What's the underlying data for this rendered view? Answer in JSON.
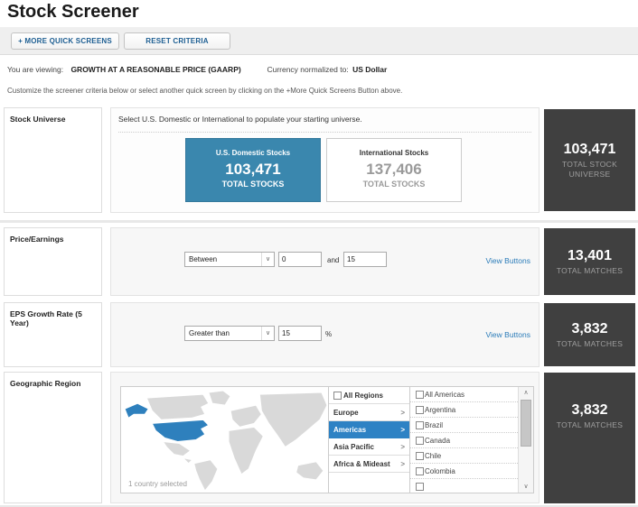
{
  "page": {
    "title": "Stock Screener"
  },
  "toolbar": {
    "more_quick_screens": "+ MORE QUICK SCREENS",
    "reset_criteria": "RESET CRITERIA"
  },
  "status": {
    "viewing_label": "You are viewing:",
    "viewing_value": "GROWTH AT A REASONABLE PRICE (GAARP)",
    "currency_label": "Currency normalized to:",
    "currency_value": "US Dollar",
    "instructions": "Customize the screener criteria below or select another quick screen by clicking on the +More Quick Screens Button above."
  },
  "colors": {
    "selected_card_blue": "#3a87ae",
    "selected_region_blue": "#2e82c4",
    "dark_panel": "#404040",
    "link_blue": "#2b7cb9",
    "map_land_gray": "#d9d9d9",
    "map_selected_blue": "#2e80bd"
  },
  "icons": {
    "select_chevron": "∨",
    "region_chevron": ">",
    "scroll_up": "∧",
    "scroll_down": "∨"
  },
  "rows": {
    "stock_universe": {
      "label": "Stock Universe",
      "instruction": "Select U.S. Domestic or International to populate your starting universe.",
      "domestic": {
        "title": "U.S. Domestic Stocks",
        "count": "103,471",
        "sub": "TOTAL STOCKS"
      },
      "international": {
        "title": "International Stocks",
        "count": "137,406",
        "sub": "TOTAL STOCKS"
      },
      "total": {
        "count": "103,471",
        "label": "TOTAL STOCK UNIVERSE"
      }
    },
    "price_earnings": {
      "label": "Price/Earnings",
      "operator": "Between",
      "value1": "0",
      "and_label": "and",
      "value2": "15",
      "view_buttons": "View Buttons",
      "total": {
        "count": "13,401",
        "label": "TOTAL MATCHES"
      }
    },
    "eps_growth": {
      "label": "EPS Growth Rate (5 Year)",
      "operator": "Greater than",
      "value1": "15",
      "unit": "%",
      "view_buttons": "View Buttons",
      "total": {
        "count": "3,832",
        "label": "TOTAL MATCHES"
      }
    },
    "geographic_region": {
      "label": "Geographic Region",
      "map_caption": "1 country selected",
      "regions": [
        {
          "label": "All Regions"
        },
        {
          "label": "Europe"
        },
        {
          "label": "Americas"
        },
        {
          "label": "Asia Pacific"
        },
        {
          "label": "Africa & Mideast"
        }
      ],
      "countries": [
        "All Americas",
        "Argentina",
        "Brazil",
        "Canada",
        "Chile",
        "Colombia"
      ],
      "total": {
        "count": "3,832",
        "label": "TOTAL MATCHES"
      }
    }
  }
}
